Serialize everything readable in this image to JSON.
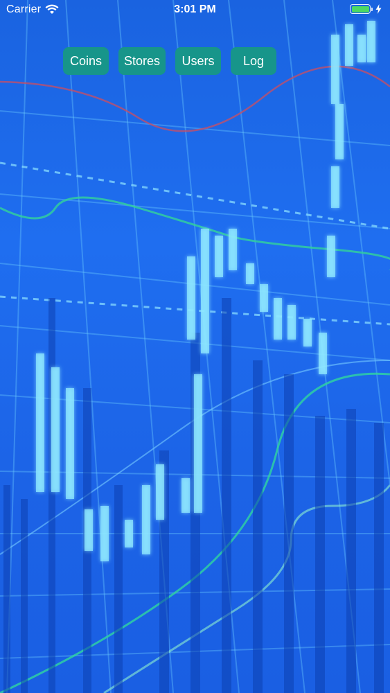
{
  "status_bar": {
    "carrier": "Carrier",
    "time": "3:01 PM",
    "battery_color": "#4cd964"
  },
  "nav": {
    "buttons": [
      {
        "label": "Coins"
      },
      {
        "label": "Stores"
      },
      {
        "label": "Users"
      },
      {
        "label": "Log"
      }
    ],
    "button_color": "#17958a"
  },
  "background": {
    "description_icon": "stock-chart-background",
    "base_color": "#1c66e8"
  }
}
